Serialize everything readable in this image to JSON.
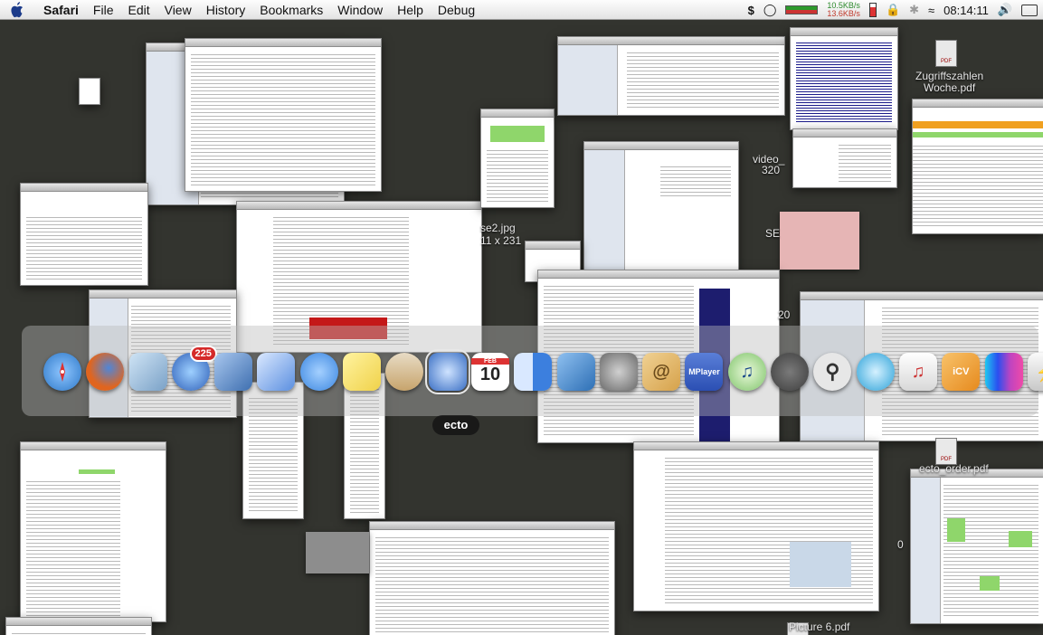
{
  "menubar": {
    "app": "Safari",
    "menus": [
      "File",
      "Edit",
      "View",
      "History",
      "Bookmarks",
      "Window",
      "Help",
      "Debug"
    ],
    "net_up": "10.5KB/s",
    "net_down": "13.6KB/s",
    "clock": "08:14:11"
  },
  "desktop": {
    "labels": [
      {
        "text": "Zugriffszahlen\nWoche.pdf"
      },
      {
        "text": "video_"
      },
      {
        "text": "320"
      },
      {
        "text": "SE"
      },
      {
        "text": "se2.jpg"
      },
      {
        "text": "11 x 231"
      },
      {
        "text": "Picture 6.pdf"
      },
      {
        "text": "ecto_order.pdf"
      },
      {
        "text": "0"
      },
      {
        "text": "20"
      }
    ]
  },
  "dock": {
    "hovered_label": "ecto",
    "ical_date": "10",
    "ical_month": "FEB",
    "mail_badge": "225",
    "mplayer_text": "MPlayer",
    "icons": [
      {
        "name": "safari",
        "color": "#2d78c8"
      },
      {
        "name": "firefox",
        "color": "#e0651f"
      },
      {
        "name": "iphoto",
        "color": "#7aa1c7"
      },
      {
        "name": "mail",
        "color": "#2e5fb8"
      },
      {
        "name": "stickies-bird",
        "color": "#3e6fb0"
      },
      {
        "name": "remote-desktop",
        "color": "#5b8fe0"
      },
      {
        "name": "ichat",
        "color": "#3b86e0"
      },
      {
        "name": "stickies",
        "color": "#f0d24a"
      },
      {
        "name": "coffee",
        "color": "#c7a46c"
      },
      {
        "name": "ecto",
        "color": "#3a6fc4"
      },
      {
        "name": "ical",
        "color": "#ffffff"
      },
      {
        "name": "finder",
        "color": "#3c7fde"
      },
      {
        "name": "book",
        "color": "#2d6fb5"
      },
      {
        "name": "einstein",
        "color": "#6a6a6a"
      },
      {
        "name": "address-book",
        "color": "#d6a24b"
      },
      {
        "name": "mplayer",
        "color": "#2b4fb3"
      },
      {
        "name": "itunes",
        "color": "#7ec46a"
      },
      {
        "name": "coffee-cup",
        "color": "#3d3d3d"
      },
      {
        "name": "spotlight",
        "color": "#e7e7e7"
      },
      {
        "name": "quicktime",
        "color": "#2aa1d8"
      },
      {
        "name": "garageband",
        "color": "#d8d8d8"
      },
      {
        "name": "icv",
        "color": "#e68a1e"
      },
      {
        "name": "colors",
        "color": "#c044c0"
      },
      {
        "name": "battery",
        "color": "#c8c8c8"
      }
    ]
  }
}
